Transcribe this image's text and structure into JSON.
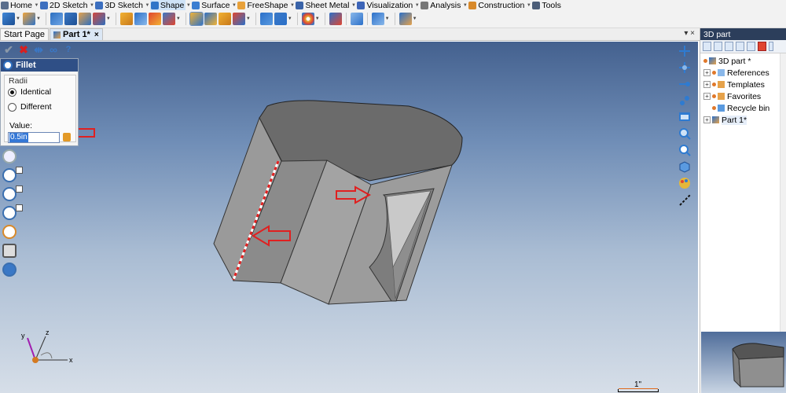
{
  "menu": {
    "items": [
      {
        "label": "Home",
        "icon": "home-icon",
        "color": "#5a6e8c"
      },
      {
        "label": "2D Sketch",
        "icon": "pencil-icon",
        "color": "#3c6fbf"
      },
      {
        "label": "3D Sketch",
        "icon": "pencil-icon",
        "color": "#3c6fbf"
      },
      {
        "label": "Shape",
        "icon": "cube-icon",
        "color": "#2e74c8",
        "active": true
      },
      {
        "label": "Surface",
        "icon": "surface-icon",
        "color": "#3b7ed1"
      },
      {
        "label": "FreeShape",
        "icon": "freeshape-icon",
        "color": "#e8a13a"
      },
      {
        "label": "Sheet Metal",
        "icon": "sheet-metal-icon",
        "color": "#3a63a8"
      },
      {
        "label": "Visualization",
        "icon": "visualization-icon",
        "color": "#3c64b8"
      },
      {
        "label": "Analysis",
        "icon": "analysis-icon",
        "color": "#777"
      },
      {
        "label": "Construction",
        "icon": "construction-icon",
        "color": "#d8892a"
      },
      {
        "label": "Tools",
        "icon": "tools-icon",
        "color": "#4b5d78"
      }
    ]
  },
  "tabs": {
    "items": [
      {
        "label": "Start Page"
      },
      {
        "label": "Part 1*",
        "active": true,
        "close": "×"
      }
    ],
    "right_controls": "▾ ×"
  },
  "fillet": {
    "title": "Fillet",
    "group_label": "Radii",
    "option_identical": "Identical",
    "option_different": "Different",
    "selected_option": "Identical",
    "value_label": "Value:",
    "value": "0.5in"
  },
  "tree": {
    "header": "3D part",
    "items": [
      {
        "label": "3D part *",
        "expand": "",
        "icon": "part-icon"
      },
      {
        "label": "References",
        "expand": "+",
        "icon": "references-icon"
      },
      {
        "label": "Templates",
        "expand": "+",
        "icon": "templates-icon"
      },
      {
        "label": "Favorites",
        "expand": "+",
        "icon": "favorites-icon"
      },
      {
        "label": "Recycle bin",
        "expand": "",
        "icon": "recycle-bin-icon"
      },
      {
        "label": "Part 1*",
        "expand": "+",
        "icon": "part-icon",
        "selected": true
      }
    ]
  },
  "axes": {
    "x": "x",
    "y": "y",
    "z": "z"
  },
  "scale": {
    "label": "1\""
  },
  "colors": {
    "menu_bg": "#f2f2f2",
    "panel_header": "#2f4f86",
    "tree_header": "#2c3e5b",
    "selection_blue": "#3477d6",
    "annotation_red": "#e02020"
  }
}
